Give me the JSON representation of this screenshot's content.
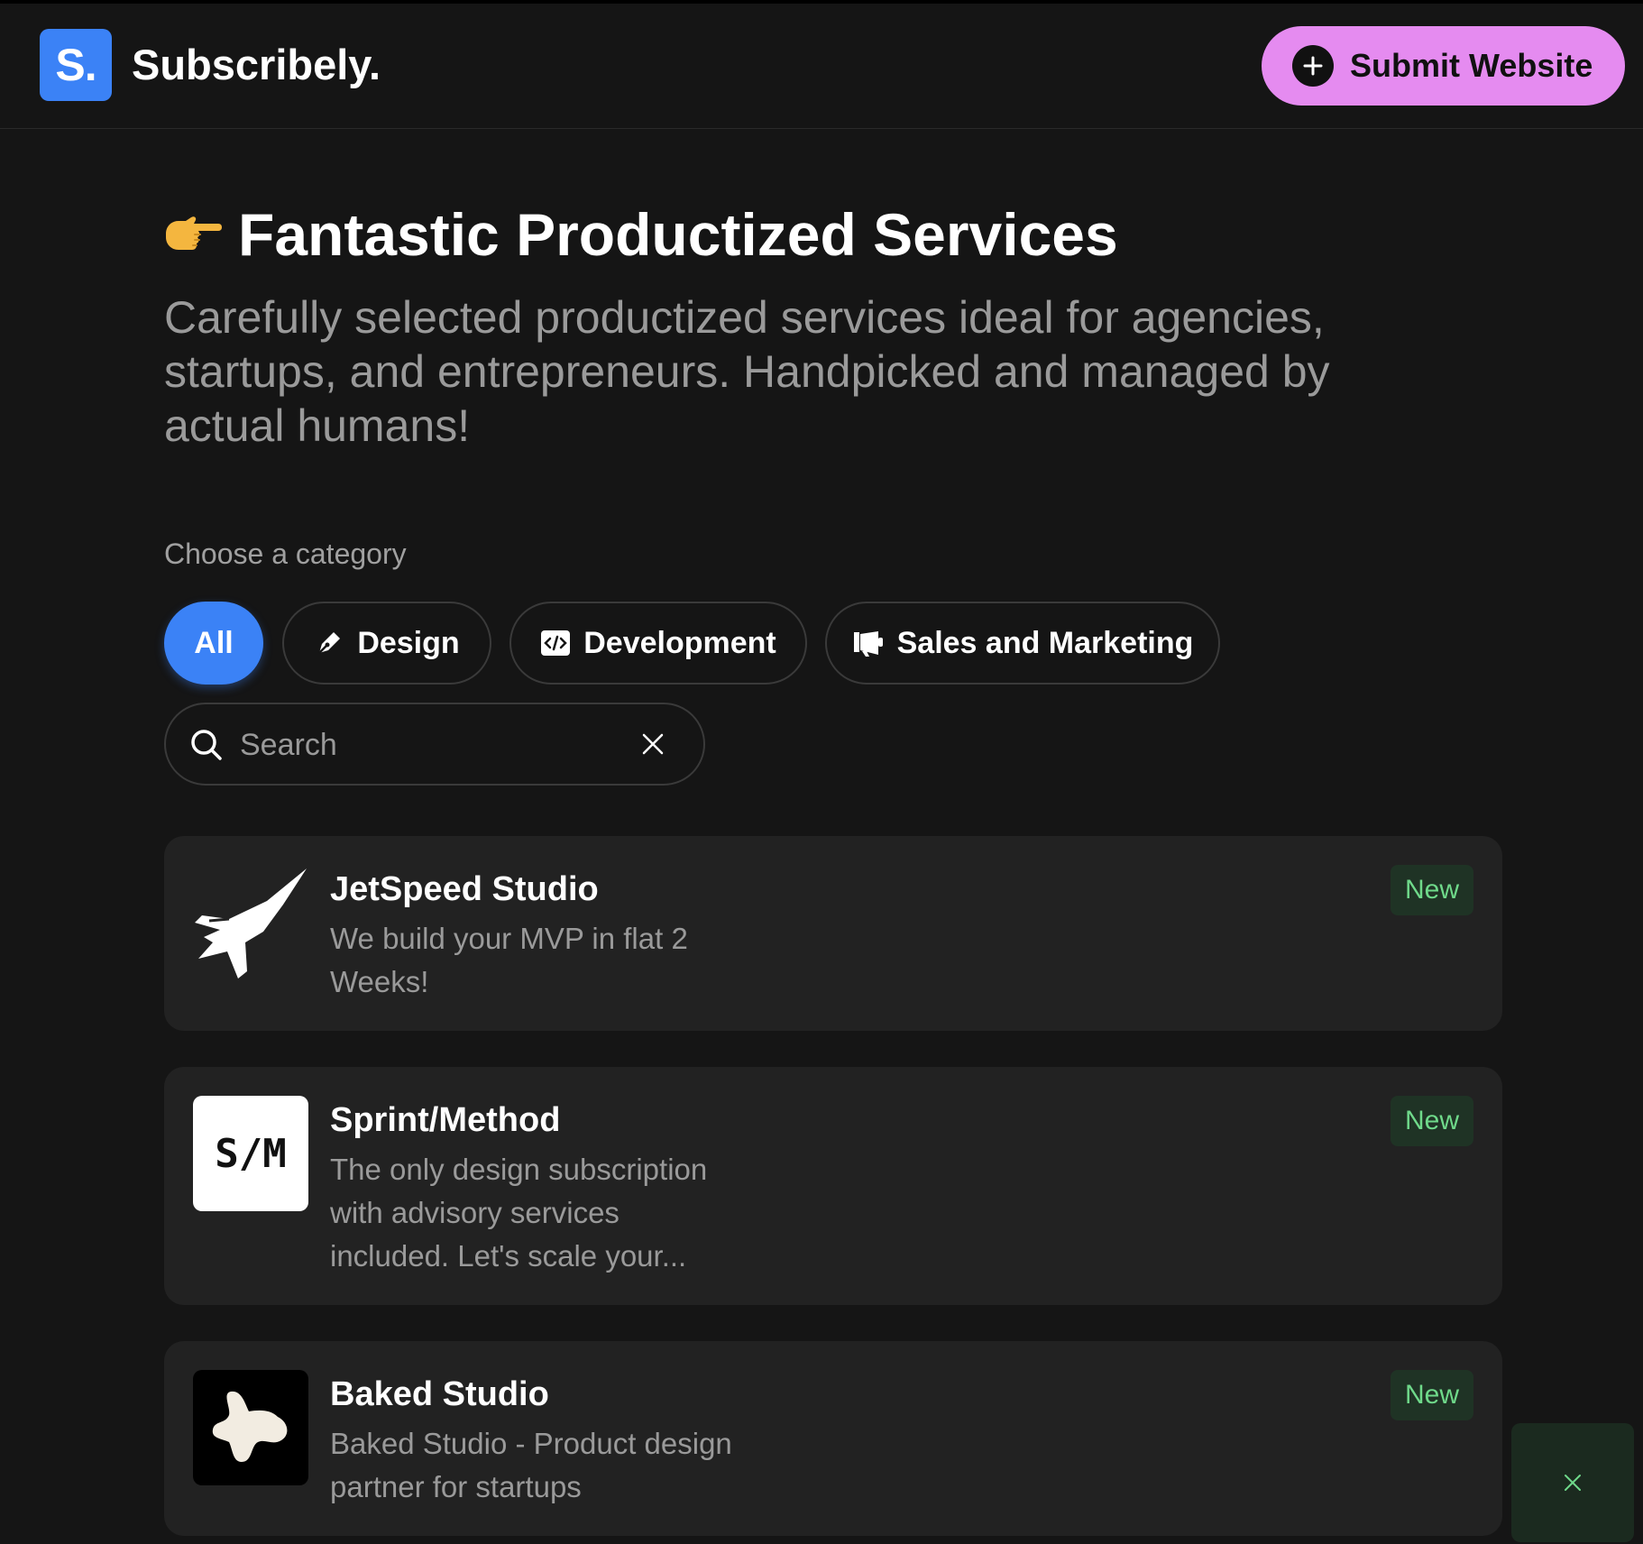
{
  "header": {
    "logo_letter": "S.",
    "brand": "Subscribely.",
    "submit_label": "Submit Website"
  },
  "hero": {
    "emoji": "👉",
    "title": "Fantastic Productized Services",
    "subtitle": "Carefully selected productized services ideal for agencies, startups, and entrepreneurs. Handpicked and managed by actual humans!"
  },
  "categories": {
    "label": "Choose a category",
    "items": [
      {
        "label": "All",
        "icon": "none",
        "active": true
      },
      {
        "label": "Design",
        "icon": "pen-icon"
      },
      {
        "label": "Development",
        "icon": "code-icon"
      },
      {
        "label": "Sales and Marketing",
        "icon": "megaphone-icon"
      }
    ]
  },
  "search": {
    "placeholder": "Search",
    "value": ""
  },
  "listings": [
    {
      "name": "JetSpeed Studio",
      "description": "We build your MVP in flat 2 Weeks!",
      "badge": "New",
      "logo": "jet-icon"
    },
    {
      "name": "Sprint/Method",
      "description": "The only design subscription with advisory services included. Let's scale your...",
      "badge": "New",
      "logo_text": "S/M"
    },
    {
      "name": "Baked Studio",
      "description": "Baked Studio - Product design partner for startups",
      "badge": "New",
      "logo": "blob-icon"
    }
  ],
  "colors": {
    "background": "#151515",
    "card": "#222222",
    "accent_blue": "#3b82f6",
    "submit_pink": "#e58bf0",
    "badge_green": "#6fd98a"
  }
}
